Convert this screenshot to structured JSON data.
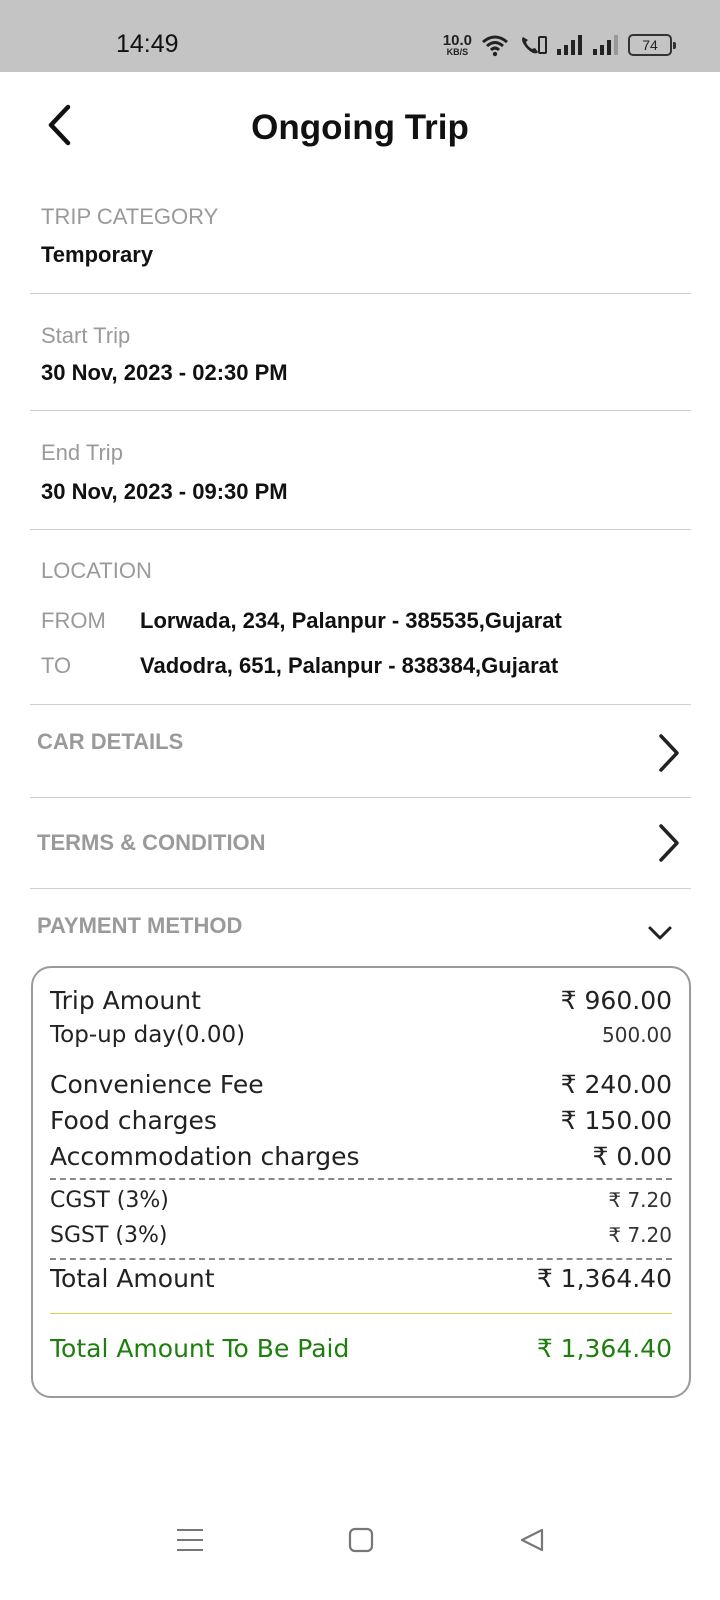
{
  "status_bar": {
    "time": "14:49",
    "net_speed_value": "10.0",
    "net_speed_unit": "KB/S",
    "battery": "74",
    "icons": [
      "wifi-icon",
      "volte-call-icon",
      "signal-icon",
      "signal-icon"
    ]
  },
  "header": {
    "title": "Ongoing Trip",
    "back_icon": "chevron-left-icon"
  },
  "trip_category": {
    "label": "TRIP CATEGORY",
    "value": "Temporary"
  },
  "start_trip": {
    "label": "Start Trip",
    "value": "30 Nov, 2023 - 02:30 PM"
  },
  "end_trip": {
    "label": "End Trip",
    "value": "30 Nov, 2023 - 09:30 PM"
  },
  "location": {
    "label": "LOCATION",
    "from_label": "FROM",
    "from_value": "Lorwada, 234, Palanpur - 385535,Gujarat",
    "to_label": "TO",
    "to_value": "Vadodra, 651, Palanpur - 838384,Gujarat"
  },
  "sections": {
    "car_details": "CAR DETAILS",
    "terms": "TERMS & CONDITION",
    "payment_method": "PAYMENT METHOD"
  },
  "payment": {
    "rows": [
      {
        "label": "Trip Amount",
        "value": "₹ 960.00"
      },
      {
        "label": "Top-up day(0.00)",
        "value": "500.00"
      },
      {
        "label": "Convenience Fee",
        "value": "₹ 240.00"
      },
      {
        "label": "Food charges",
        "value": "₹ 150.00"
      },
      {
        "label": "Accommodation charges",
        "value": "₹ 0.00"
      },
      {
        "label": "CGST (3%)",
        "value": "₹ 7.20"
      },
      {
        "label": "SGST (3%)",
        "value": "₹ 7.20"
      },
      {
        "label": "Total Amount",
        "value": "₹ 1,364.40"
      }
    ],
    "payable_label": "Total  Amount To Be Paid",
    "payable_value": "₹ 1,364.40"
  },
  "colors": {
    "status_bar_bg": "#c4c4c4",
    "label_gray": "#9a9a9a",
    "payable_green": "#1e7e0e"
  },
  "system_nav": [
    "menu-icon",
    "home-square-icon",
    "back-triangle-icon"
  ]
}
